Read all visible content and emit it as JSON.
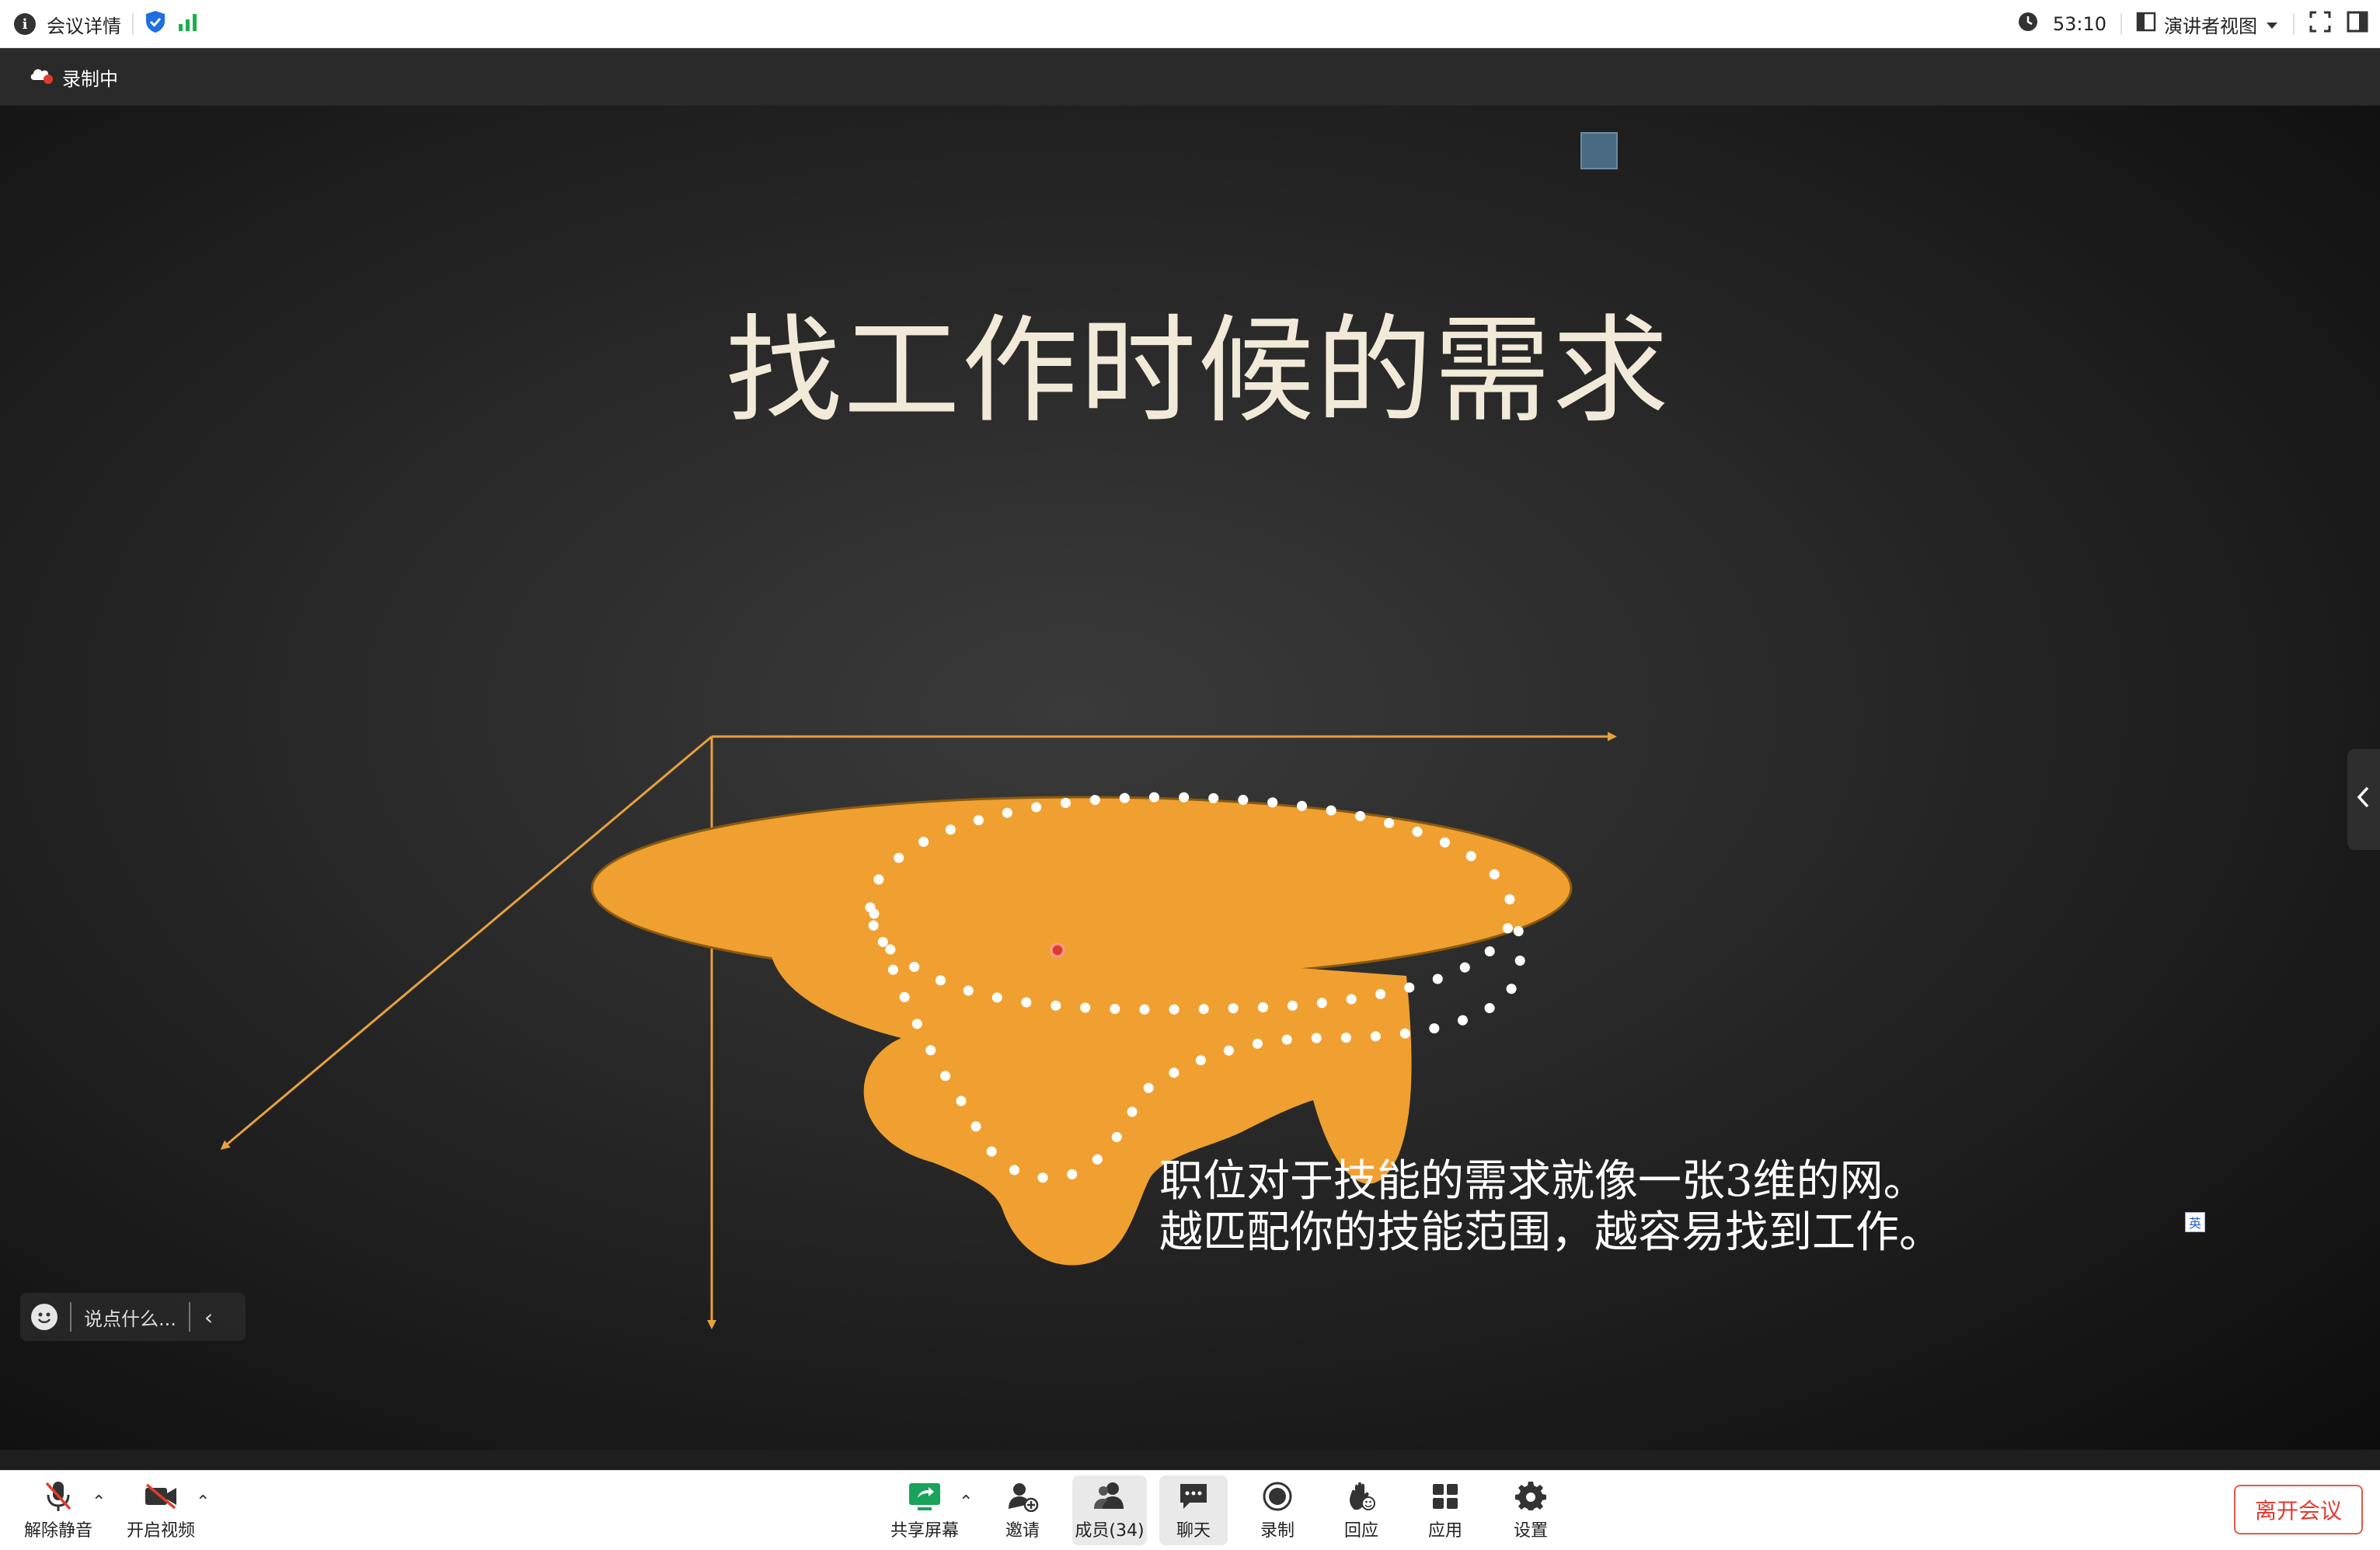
{
  "topbar": {
    "meeting_details": "会议详情",
    "timer": "53:10",
    "view_mode": "演讲者视图"
  },
  "recording": {
    "label": "录制中"
  },
  "slide": {
    "title": "找工作时候的需求",
    "body": "职位对于技能的需求就像一张3维的网。越匹配你的技能范围，越容易找到工作。",
    "lang_badge": "英"
  },
  "chat": {
    "placeholder": "说点什么..."
  },
  "toolbar": {
    "unmute": "解除静音",
    "start_video": "开启视频",
    "share_screen": "共享屏幕",
    "invite": "邀请",
    "members": "成员(34)",
    "chat": "聊天",
    "record": "录制",
    "reactions": "回应",
    "apps": "应用",
    "settings": "设置",
    "leave": "离开会议"
  },
  "colors": {
    "shape_fill": "#f0a030",
    "arrow": "#e8a040",
    "leave_red": "#e23b2e",
    "share_green": "#1aa35a",
    "shield_blue": "#1e6fe0",
    "signal_green": "#19b14b"
  }
}
